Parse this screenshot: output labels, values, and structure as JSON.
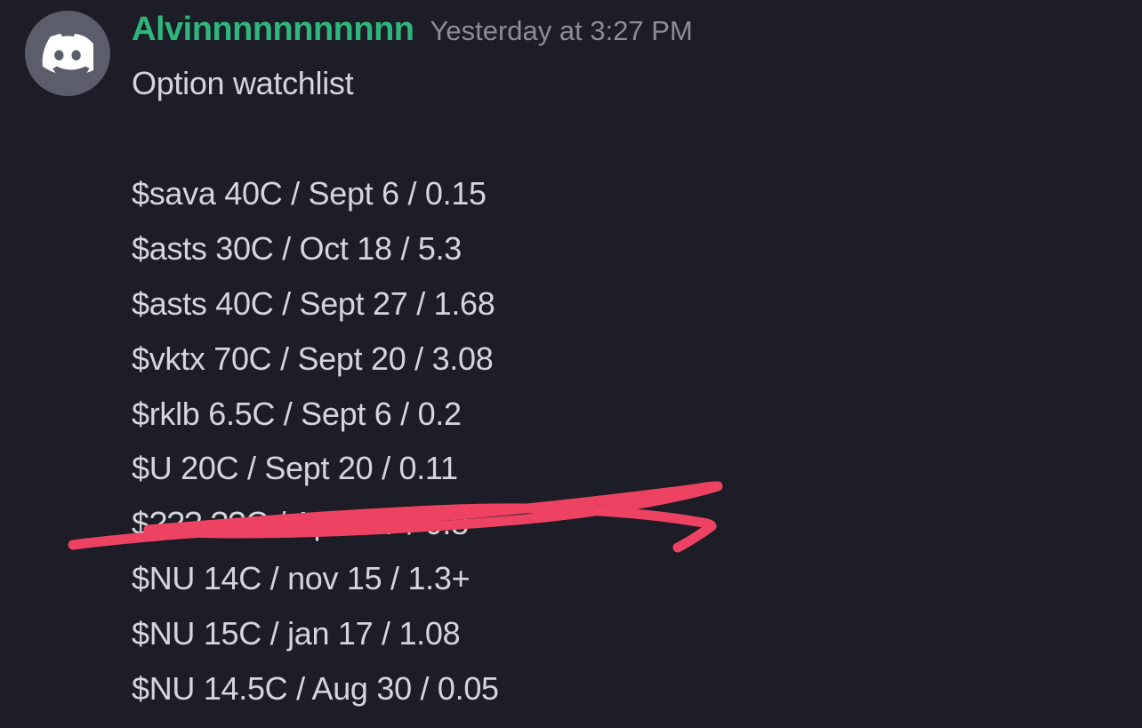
{
  "message": {
    "author": "Alvinnnnnnnnnnn",
    "timestamp": "Yesterday at 3:27 PM",
    "header_line": "Option watchlist",
    "lines": [
      "$sava  40C / Sept 6 / 0.15",
      "$asts 30C / Oct 18 / 5.3",
      "$asts 40C / Sept 27 / 1.68",
      "$vktx 70C / Sept 20 / 3.08",
      "$rklb 6.5C / Sept 6 / 0.2",
      "$U 20C / Sept 20 / 0.11",
      "$??? ??C / April 17 / 0.8",
      "$NU 14C / nov 15 / 1.3+",
      "$NU 15C / jan 17 / 1.08",
      "$NU 14.5C / Aug 30 / 0.05"
    ],
    "scribbled_line_index": 6
  },
  "colors": {
    "background": "#1c1d26",
    "username": "#2fb67c",
    "timestamp": "#8b8d97",
    "text": "#d5d6db",
    "avatar_bg": "#5b5d6a",
    "scribble": "#ed4261"
  }
}
